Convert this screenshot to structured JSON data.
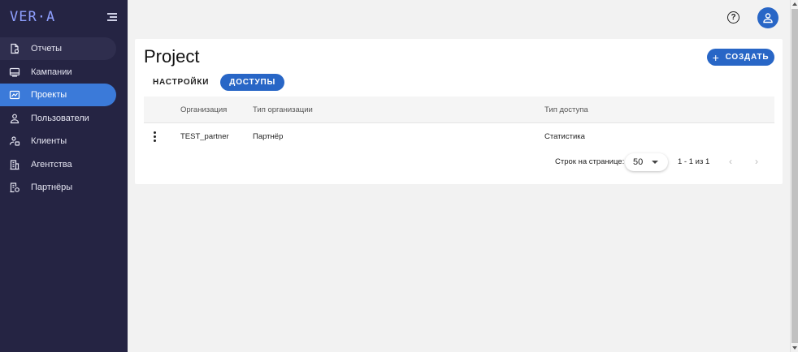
{
  "app": {
    "logo": "VER·A"
  },
  "sidebar": {
    "items": [
      {
        "label": "Отчеты",
        "icon": "report-icon",
        "state": "hover"
      },
      {
        "label": "Кампании",
        "icon": "campaign-icon",
        "state": ""
      },
      {
        "label": "Проекты",
        "icon": "project-icon",
        "state": "active"
      },
      {
        "label": "Пользователи",
        "icon": "users-icon",
        "state": ""
      },
      {
        "label": "Клиенты",
        "icon": "clients-icon",
        "state": ""
      },
      {
        "label": "Агентства",
        "icon": "agency-icon",
        "state": ""
      },
      {
        "label": "Партнёры",
        "icon": "partners-icon",
        "state": ""
      }
    ]
  },
  "header": {
    "help_icon": "help-icon",
    "profile_icon": "user-icon"
  },
  "main": {
    "title": "Project",
    "create_label": "СОЗДАТЬ",
    "tabs": [
      {
        "label": "НАСТРОЙКИ",
        "active": false
      },
      {
        "label": "ДОСТУПЫ",
        "active": true
      }
    ],
    "table": {
      "columns": [
        "",
        "Организация",
        "Тип организации",
        "Тип доступа"
      ],
      "rows": [
        [
          "",
          "TEST_partner",
          "Партнёр",
          "Статистика"
        ]
      ]
    },
    "pagination": {
      "rows_per_page_label": "Строк на странице:",
      "rows_per_page": "50",
      "range": "1 - 1 из 1",
      "prev": "‹",
      "next": "›"
    }
  },
  "colors": {
    "sidebar_bg": "#252443",
    "accent": "#2866c6",
    "active_nav": "#3b7ad9",
    "logo": "#8fa0ff"
  }
}
